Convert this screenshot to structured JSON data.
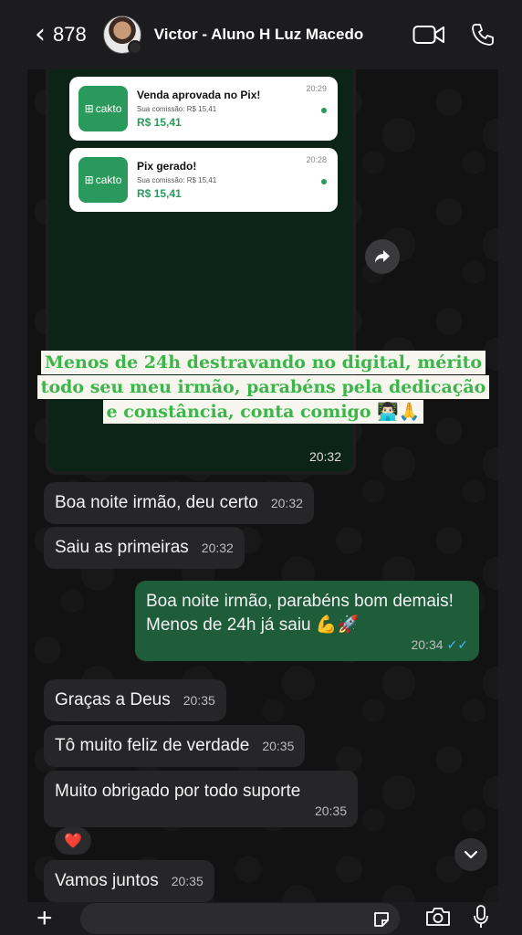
{
  "header": {
    "back_count": "878",
    "contact_name": "Victor - Aluno H Luz Macedo"
  },
  "image_message": {
    "notifications": [
      {
        "logo": "cakto",
        "title": "Venda aprovada no Pix!",
        "sub": "Sua comissão: R$ 15,41",
        "amount": "R$ 15,41",
        "time": "20:29"
      },
      {
        "logo": "cakto",
        "title": "Pix gerado!",
        "sub": "Sua comissão: R$ 15,41",
        "amount": "R$ 15,41",
        "time": "20:28"
      }
    ],
    "caption_lines": [
      "Menos de 24h destravando no digital, mérito",
      "todo seu meu irmão, parabéns pela dedicação",
      "e constância, conta comigo 👨🏻‍💻🙏"
    ],
    "time": "20:32"
  },
  "messages": [
    {
      "dir": "in",
      "text": "Boa noite irmão, deu certo",
      "time": "20:32"
    },
    {
      "dir": "in",
      "text": "Saiu as primeiras",
      "time": "20:32"
    },
    {
      "dir": "out",
      "text": "Boa noite irmão, parabéns bom demais! Menos de 24h já saiu 💪🚀",
      "time": "20:34"
    },
    {
      "dir": "in",
      "text": "Graças a Deus",
      "time": "20:35"
    },
    {
      "dir": "in",
      "text": "Tô muito feliz de verdade",
      "time": "20:35"
    },
    {
      "dir": "in",
      "text": "Muito obrigado por todo suporte",
      "time": "20:35"
    },
    {
      "dir": "in",
      "text": "Vamos juntos",
      "time": "20:35"
    }
  ],
  "reaction": "❤️",
  "ticks": "✓✓",
  "colors": {
    "outgoing": "#1f5c3a",
    "incoming": "#262628",
    "caption_green": "#3cb64a",
    "read_ticks": "#4fb3ff"
  }
}
